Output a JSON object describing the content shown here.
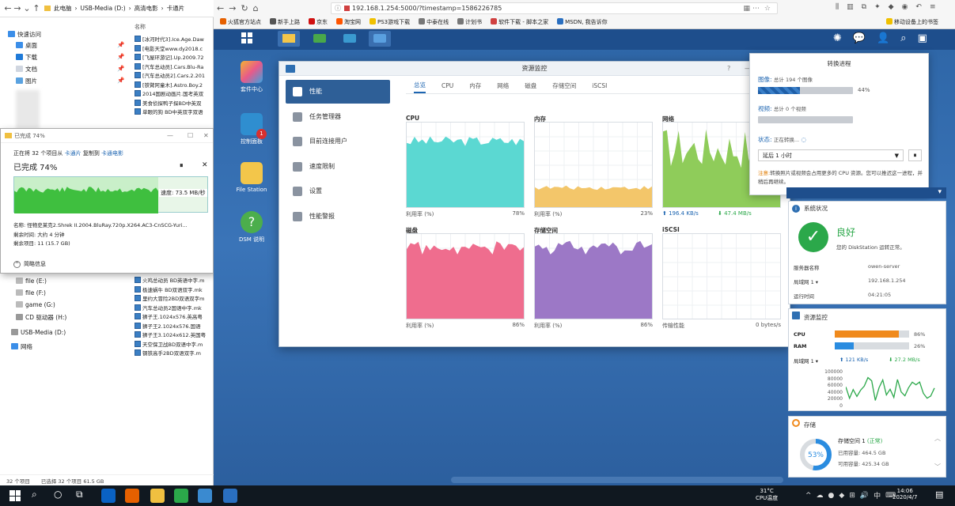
{
  "explorer": {
    "breadcrumb": [
      "此电脑",
      "USB-Media (D:)",
      "高清电影",
      "卡通片"
    ],
    "column_name": "名称",
    "quick_access": "快速访问",
    "nav": [
      "桌面",
      "下载",
      "文档",
      "图片"
    ],
    "drives": [
      "file (E:)",
      "file (F:)",
      "game (G:)",
      "CD 驱动器 (H:)",
      "USB-Media (D:)",
      "网络"
    ],
    "files_top": [
      "[冰河时代3].Ice.Age.Daw",
      "[电影天堂www.dy2018.c",
      "[飞屋环游记].Up.2009.72",
      "[汽车总动员].Cars.Blu-Ra",
      "[汽车总动员2].Cars.2.201",
      "[铁臂阿童木].Astro.Boy.2",
      "2014国剧动画片.国考英双",
      "美食侦探鸭子探BD中英双",
      "单眼的狗 BD中英双字双语"
    ],
    "files_bottom": [
      "火鸡总动员 BD英语中字.m",
      "极速蜗牛 BD双语双字.mk",
      "里约大冒险2BD双语双字m",
      "汽车总动员2国语中字.mk",
      "狮子王.1024x576.英高粤",
      "狮子王2.1024x576.国语",
      "狮子王3.1024x612.英国粤",
      "天空保卫战BD双语中字.m",
      "钢铁高手2BD双语双字.m"
    ],
    "status": [
      "32 个项目",
      "已选择 32 个项目 61.5 GB"
    ]
  },
  "copy_dialog": {
    "title": "已完成 74%",
    "line1_prefix": "正在将 32 个项目从 ",
    "line1_src": "卡通片",
    "line1_mid": " 复制到 ",
    "line1_dst": "卡通电影",
    "heading": "已完成 74%",
    "speed": "速度: 73.5 MB/秒",
    "name": "名称: 怪物史莱克2.Shrek II.2004.BluRay.720p.X264.AC3-CnSCG-Yuri...",
    "remaining_time": "剩余时间: 大约 4 分钟",
    "remaining_items": "剩余项目: 11 (15.7 GB)",
    "less_info": "简略信息",
    "progress_pct": 74
  },
  "browser": {
    "url": "192.168.1.254:5000/?timestamp=1586226785",
    "bookmarks": [
      "火狐官方站点",
      "新手上路",
      "京东",
      "淘宝网",
      "PS3游戏下载",
      "中泰在线",
      "计划书",
      "软件下载 - 脚本之家",
      "MSDN, 我告诉你"
    ],
    "mobile_bm": "移动设备上的书签"
  },
  "desktop": {
    "icons": [
      "套件中心",
      "控制面板",
      "File Station",
      "DSM 说明"
    ],
    "badge": "1"
  },
  "resource_monitor": {
    "title": "资源监控",
    "sidebar": [
      "性能",
      "任务管理器",
      "目前连接用户",
      "速度限制",
      "设置",
      "性能警报"
    ],
    "tabs": [
      "总览",
      "CPU",
      "内存",
      "网络",
      "磁盘",
      "存储空间",
      "iSCSI"
    ],
    "panels": [
      {
        "label": "CPU",
        "foot": "利用率 (%)",
        "value": "78%",
        "color": "#5bd8d2",
        "level": 0.78
      },
      {
        "label": "内存",
        "foot": "利用率 (%)",
        "value": "23%",
        "color": "#f3c66a",
        "level": 0.23
      },
      {
        "label": "网络",
        "up": "196.4 KB/s",
        "down": "47.4 MB/s",
        "color": "#8fcc5a",
        "level": 0.7
      },
      {
        "label": "磁盘",
        "foot": "利用率 (%)",
        "value": "86%",
        "color": "#ef6d8e",
        "level": 0.86
      },
      {
        "label": "存储空间",
        "foot": "利用率 (%)",
        "value": "86%",
        "color": "#9c78c6",
        "level": 0.86
      },
      {
        "label": "iSCSI",
        "foot": "传输性能",
        "value": "0 bytes/s",
        "color": "#cccccc",
        "level": 0
      }
    ]
  },
  "conversion_popup": {
    "title": "转换进程",
    "images_label": "图像:",
    "images_sub": "总计 194 个图像",
    "images_pct": "44%",
    "images_fill": 0.44,
    "videos_label": "视频:",
    "videos_sub": "总计 0 个视频",
    "status_label": "状态:",
    "status_sub": "正在转换...",
    "delay_option": "延后 1 小时",
    "note_label": "注意:",
    "note": "转换照片或视频会占用更多的 CPU 资源。您可以推迟这一进程，并稍后再继续。"
  },
  "system_health": {
    "title": "系统状况",
    "status": "良好",
    "message": "您的 DiskStation 运转正常。",
    "rows": [
      [
        "服务器名称",
        "owen-server"
      ],
      [
        "局域网 1",
        "192.168.1.254"
      ],
      [
        "运行时间",
        "04:21:05"
      ]
    ]
  },
  "resource_widget": {
    "title": "资源监控",
    "cpu_label": "CPU",
    "cpu_value": "86%",
    "cpu_fill": 0.86,
    "ram_label": "RAM",
    "ram_value": "26%",
    "ram_fill": 0.26,
    "lan_label": "局域网 1",
    "up": "121 KB/s",
    "down": "27.2 MB/s",
    "y_ticks": [
      "100000",
      "80000",
      "60000",
      "40000",
      "20000",
      "0"
    ]
  },
  "storage_widget": {
    "title": "存储",
    "pct": "53%",
    "pct_fill": 0.53,
    "volume": "存储空间 1",
    "volume_status": "(正常)",
    "used": "已用容量: 464.5 GB",
    "free": "可用容量: 425.34 GB"
  },
  "taskbar": {
    "temp": "31°C",
    "temp_label": "CPU温度",
    "time": "14:06",
    "date": "2020/4/7",
    "ime": "中"
  }
}
